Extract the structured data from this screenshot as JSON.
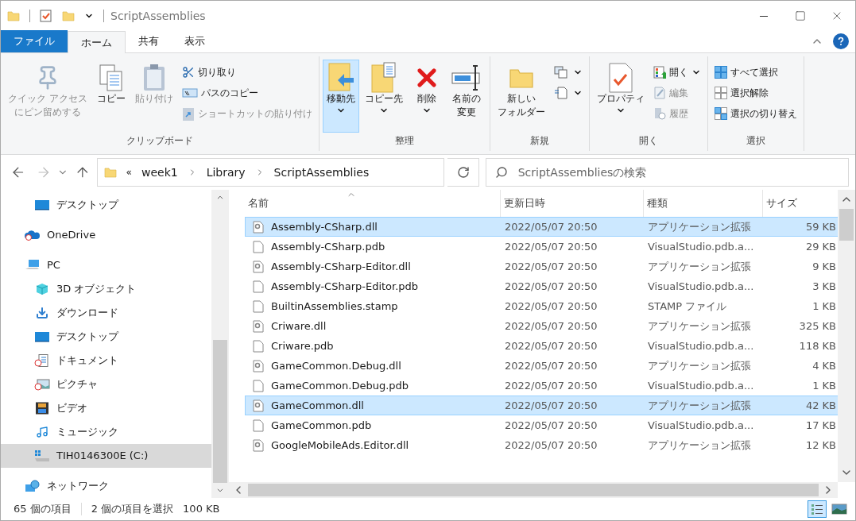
{
  "window": {
    "title": "ScriptAssemblies"
  },
  "ribbon_tabs": [
    {
      "label": "ファイル",
      "kind": "file",
      "selected": false
    },
    {
      "label": "ホーム",
      "kind": "tab",
      "selected": true
    },
    {
      "label": "共有",
      "kind": "tab",
      "selected": false
    },
    {
      "label": "表示",
      "kind": "tab",
      "selected": false
    }
  ],
  "ribbon_groups": [
    {
      "label": "クリップボード",
      "large": [
        {
          "lines": [
            "クイック アクセス",
            "にピン留めする"
          ],
          "kind": "pin",
          "disabled": true,
          "selected": false,
          "dropdown": false
        },
        {
          "lines": [
            "コピー"
          ],
          "kind": "copy",
          "disabled": false,
          "selected": false,
          "dropdown": false
        },
        {
          "lines": [
            "貼り付け"
          ],
          "kind": "paste",
          "disabled": true,
          "selected": false,
          "dropdown": false
        }
      ],
      "small": [
        {
          "label": "切り取り",
          "kind": "cut",
          "disabled": false,
          "dropdown": false
        },
        {
          "label": "パスのコピー",
          "kind": "path",
          "disabled": false,
          "dropdown": false
        },
        {
          "label": "ショートカットの貼り付け",
          "kind": "shortcut",
          "disabled": true,
          "dropdown": false
        }
      ]
    },
    {
      "label": "整理",
      "large": [
        {
          "lines": [
            "移動先"
          ],
          "kind": "move",
          "disabled": false,
          "selected": true,
          "dropdown": true
        },
        {
          "lines": [
            "コピー先"
          ],
          "kind": "copyto",
          "disabled": false,
          "selected": false,
          "dropdown": true
        },
        {
          "lines": [
            "削除"
          ],
          "kind": "delete",
          "disabled": false,
          "selected": false,
          "dropdown": true
        },
        {
          "lines": [
            "名前の",
            "変更"
          ],
          "kind": "rename",
          "disabled": false,
          "selected": false,
          "dropdown": false
        }
      ]
    },
    {
      "label": "新規",
      "large": [
        {
          "lines": [
            "新しい",
            "フォルダー"
          ],
          "kind": "newfolder",
          "disabled": false,
          "selected": false,
          "dropdown": false
        }
      ],
      "small": [
        {
          "kind": "newitem",
          "disabled": false,
          "dropdown": true
        },
        {
          "kind": "easyaccess",
          "disabled": false,
          "dropdown": true
        }
      ]
    },
    {
      "label": "開く",
      "large": [
        {
          "lines": [
            "プロパティ"
          ],
          "kind": "properties",
          "disabled": false,
          "selected": false,
          "dropdown": true
        }
      ],
      "small": [
        {
          "label": "開く",
          "kind": "open",
          "disabled": false,
          "dropdown": true
        },
        {
          "label": "編集",
          "kind": "edit",
          "disabled": true,
          "dropdown": false
        },
        {
          "label": "履歴",
          "kind": "history",
          "disabled": true,
          "dropdown": false
        }
      ]
    },
    {
      "label": "選択",
      "small": [
        {
          "label": "すべて選択",
          "kind": "selectall",
          "disabled": false,
          "dropdown": false
        },
        {
          "label": "選択解除",
          "kind": "selectnone",
          "disabled": false,
          "dropdown": false
        },
        {
          "label": "選択の切り替え",
          "kind": "invert",
          "disabled": false,
          "dropdown": false
        }
      ]
    }
  ],
  "address_bar": {
    "overflow": "«",
    "breadcrumbs": [
      "week1",
      "Library",
      "ScriptAssemblies"
    ]
  },
  "search": {
    "placeholder": "ScriptAssembliesの検索"
  },
  "quick_access_items": [
    {
      "label": "デスクトップ",
      "kind": "desktop",
      "selected": false
    }
  ],
  "nav_tree": [
    {
      "label": "OneDrive",
      "kind": "onedrive",
      "selected": false
    },
    {
      "label": "PC",
      "kind": "pc",
      "selected": false,
      "children": [
        {
          "label": "3D オブジェクト",
          "kind": "cube",
          "selected": false
        },
        {
          "label": "ダウンロード",
          "kind": "download",
          "selected": false
        },
        {
          "label": "デスクトップ",
          "kind": "desktop",
          "selected": false
        },
        {
          "label": "ドキュメント",
          "kind": "documents",
          "selected": false
        },
        {
          "label": "ピクチャ",
          "kind": "pictures",
          "selected": false
        },
        {
          "label": "ビデオ",
          "kind": "video",
          "selected": false
        },
        {
          "label": "ミュージック",
          "kind": "music",
          "selected": false
        },
        {
          "label": "TIH0146300E (C:)",
          "kind": "drive",
          "selected": true
        }
      ]
    },
    {
      "label": "ネットワーク",
      "kind": "network",
      "selected": false
    }
  ],
  "columns": [
    {
      "label": "名前",
      "sorted": true
    },
    {
      "label": "更新日時",
      "sorted": false
    },
    {
      "label": "種類",
      "sorted": false
    },
    {
      "label": "サイズ",
      "sorted": false
    }
  ],
  "rows": [
    {
      "name": "Assembly-CSharp.dll",
      "date": "2022/05/07 20:50",
      "type": "アプリケーション拡張",
      "size": "59 KB",
      "kind": "dll",
      "selected": true
    },
    {
      "name": "Assembly-CSharp.pdb",
      "date": "2022/05/07 20:50",
      "type": "VisualStudio.pdb.a...",
      "size": "29 KB",
      "kind": "file",
      "selected": false
    },
    {
      "name": "Assembly-CSharp-Editor.dll",
      "date": "2022/05/07 20:50",
      "type": "アプリケーション拡張",
      "size": "9 KB",
      "kind": "dll",
      "selected": false
    },
    {
      "name": "Assembly-CSharp-Editor.pdb",
      "date": "2022/05/07 20:50",
      "type": "VisualStudio.pdb.a...",
      "size": "3 KB",
      "kind": "file",
      "selected": false
    },
    {
      "name": "BuiltinAssemblies.stamp",
      "date": "2022/05/07 20:50",
      "type": "STAMP ファイル",
      "size": "1 KB",
      "kind": "file",
      "selected": false
    },
    {
      "name": "Criware.dll",
      "date": "2022/05/07 20:50",
      "type": "アプリケーション拡張",
      "size": "325 KB",
      "kind": "dll",
      "selected": false
    },
    {
      "name": "Criware.pdb",
      "date": "2022/05/07 20:50",
      "type": "VisualStudio.pdb.a...",
      "size": "118 KB",
      "kind": "file",
      "selected": false
    },
    {
      "name": "GameCommon.Debug.dll",
      "date": "2022/05/07 20:50",
      "type": "アプリケーション拡張",
      "size": "4 KB",
      "kind": "dll",
      "selected": false
    },
    {
      "name": "GameCommon.Debug.pdb",
      "date": "2022/05/07 20:50",
      "type": "VisualStudio.pdb.a...",
      "size": "1 KB",
      "kind": "file",
      "selected": false
    },
    {
      "name": "GameCommon.dll",
      "date": "2022/05/07 20:50",
      "type": "アプリケーション拡張",
      "size": "42 KB",
      "kind": "dll",
      "selected": true
    },
    {
      "name": "GameCommon.pdb",
      "date": "2022/05/07 20:50",
      "type": "VisualStudio.pdb.a...",
      "size": "17 KB",
      "kind": "file",
      "selected": false
    },
    {
      "name": "GoogleMobileAds.Editor.dll",
      "date": "2022/05/07 20:50",
      "type": "アプリケーション拡張",
      "size": "12 KB",
      "kind": "dll",
      "selected": false
    }
  ],
  "status_bar": {
    "item_count": "65 個の項目",
    "selection": "2 個の項目を選択",
    "selection_size": "100 KB"
  },
  "view_buttons": [
    {
      "kind": "details",
      "selected": true
    },
    {
      "kind": "tiles",
      "selected": false
    }
  ]
}
